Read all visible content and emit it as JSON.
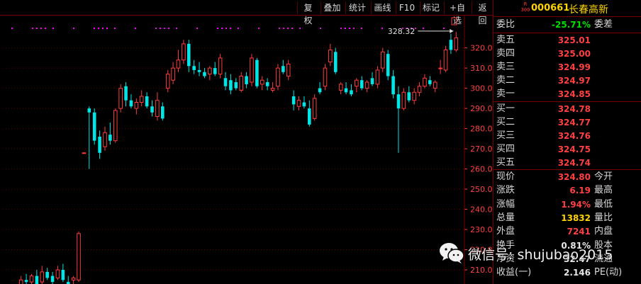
{
  "toolbar": {
    "buttons": [
      "复权",
      "叠加",
      "统计",
      "画线",
      "F10",
      "标记",
      "+自选",
      "返回"
    ]
  },
  "stock": {
    "r_badge_top": "R",
    "r_badge_bottom": "300",
    "code": "000661",
    "name": "长春高新"
  },
  "weibi": {
    "label": "委比",
    "value": "-25.71%",
    "label2": "委差"
  },
  "asks": [
    {
      "label": "卖五",
      "price": "325.01"
    },
    {
      "label": "卖四",
      "price": "325.00"
    },
    {
      "label": "卖三",
      "price": "324.99"
    },
    {
      "label": "卖二",
      "price": "324.97"
    },
    {
      "label": "卖一",
      "price": "324.85"
    }
  ],
  "bids": [
    {
      "label": "买一",
      "price": "324.78"
    },
    {
      "label": "买二",
      "price": "324.77"
    },
    {
      "label": "买三",
      "price": "324.76"
    },
    {
      "label": "买四",
      "price": "324.75"
    },
    {
      "label": "买五",
      "price": "324.74"
    }
  ],
  "quote": [
    {
      "label": "现价",
      "value": "324.80",
      "label2": "今开",
      "color": "#ff4040"
    },
    {
      "label": "涨跌",
      "value": "6.19",
      "label2": "最高",
      "color": "#ff4040"
    },
    {
      "label": "涨幅",
      "value": "1.94%",
      "label2": "最低",
      "color": "#ff4040"
    },
    {
      "label": "总量",
      "value": "13832",
      "label2": "量比",
      "color": "#ffd300"
    },
    {
      "label": "外盘",
      "value": "7241",
      "label2": "内盘",
      "color": "#ff4040"
    },
    {
      "label": "换手",
      "value": "0.81%",
      "label2": "股本",
      "color": "#e8e8e8"
    },
    {
      "label": "净资",
      "value": "32.47",
      "label2": "流通",
      "color": "#e8e8e8"
    },
    {
      "label": "收益(一)",
      "value": "2.146",
      "label2": "PE(动)",
      "color": "#e8e8e8"
    }
  ],
  "watermark": {
    "text": "微信号: shujubao2015"
  },
  "chart_data": {
    "type": "candlestick",
    "ylim": [
      203,
      336
    ],
    "yticks": [
      210,
      220,
      230,
      240,
      250,
      260,
      270,
      280,
      290,
      300,
      310,
      320
    ],
    "annotation": {
      "text": "328.32",
      "value": 328.32
    },
    "candles": [
      {
        "o": 202,
        "h": 207,
        "l": 201,
        "c": 205
      },
      {
        "o": 205,
        "h": 208,
        "l": 202,
        "c": 204
      },
      {
        "o": 204,
        "h": 208,
        "l": 203,
        "c": 207
      },
      {
        "o": 207,
        "h": 210,
        "l": 203,
        "c": 203
      },
      {
        "o": 204,
        "h": 212,
        "l": 203,
        "c": 209
      },
      {
        "o": 209,
        "h": 211,
        "l": 205,
        "c": 206
      },
      {
        "o": 207,
        "h": 209,
        "l": 203,
        "c": 204
      },
      {
        "o": 206,
        "h": 212,
        "l": 205,
        "c": 210
      },
      {
        "o": 210,
        "h": 213,
        "l": 204,
        "c": 205
      },
      {
        "o": 204,
        "h": 207,
        "l": 202,
        "c": 203
      },
      {
        "o": 205,
        "h": 207,
        "l": 203,
        "c": 206
      },
      {
        "o": 205,
        "h": 229,
        "l": 204,
        "c": 228
      },
      {
        "o": 268,
        "h": 268,
        "l": 268,
        "c": 268
      },
      {
        "o": 290,
        "h": 291,
        "l": 260,
        "c": 288
      },
      {
        "o": 288,
        "h": 290,
        "l": 272,
        "c": 274
      },
      {
        "o": 276,
        "h": 279,
        "l": 265,
        "c": 268
      },
      {
        "o": 271,
        "h": 281,
        "l": 269,
        "c": 278
      },
      {
        "o": 277,
        "h": 283,
        "l": 272,
        "c": 274
      },
      {
        "o": 274,
        "h": 290,
        "l": 273,
        "c": 289
      },
      {
        "o": 290,
        "h": 302,
        "l": 288,
        "c": 300
      },
      {
        "o": 301,
        "h": 303,
        "l": 291,
        "c": 294
      },
      {
        "o": 294,
        "h": 297,
        "l": 290,
        "c": 291
      },
      {
        "o": 290,
        "h": 295,
        "l": 287,
        "c": 293
      },
      {
        "o": 293,
        "h": 299,
        "l": 291,
        "c": 296
      },
      {
        "o": 296,
        "h": 298,
        "l": 290,
        "c": 291
      },
      {
        "o": 291,
        "h": 294,
        "l": 286,
        "c": 288
      },
      {
        "o": 286,
        "h": 298,
        "l": 284,
        "c": 294
      },
      {
        "o": 291,
        "h": 293,
        "l": 284,
        "c": 285
      },
      {
        "o": 300,
        "h": 309,
        "l": 298,
        "c": 307
      },
      {
        "o": 304,
        "h": 313,
        "l": 302,
        "c": 310
      },
      {
        "o": 310,
        "h": 319,
        "l": 308,
        "c": 314
      },
      {
        "o": 314,
        "h": 324,
        "l": 312,
        "c": 322
      },
      {
        "o": 322,
        "h": 324,
        "l": 308,
        "c": 311
      },
      {
        "o": 311,
        "h": 314,
        "l": 307,
        "c": 309
      },
      {
        "o": 309,
        "h": 313,
        "l": 306,
        "c": 308
      },
      {
        "o": 308,
        "h": 310,
        "l": 305,
        "c": 306
      },
      {
        "o": 307,
        "h": 311,
        "l": 304,
        "c": 310
      },
      {
        "o": 310,
        "h": 313,
        "l": 306,
        "c": 307
      },
      {
        "o": 307,
        "h": 317,
        "l": 305,
        "c": 315
      },
      {
        "o": 305,
        "h": 308,
        "l": 299,
        "c": 301
      },
      {
        "o": 304,
        "h": 307,
        "l": 297,
        "c": 299
      },
      {
        "o": 303,
        "h": 305,
        "l": 299,
        "c": 300
      },
      {
        "o": 299,
        "h": 308,
        "l": 298,
        "c": 306
      },
      {
        "o": 306,
        "h": 308,
        "l": 300,
        "c": 302
      },
      {
        "o": 303,
        "h": 317,
        "l": 301,
        "c": 315
      },
      {
        "o": 314,
        "h": 315,
        "l": 300,
        "c": 301
      },
      {
        "o": 302,
        "h": 306,
        "l": 299,
        "c": 304
      },
      {
        "o": 303,
        "h": 305,
        "l": 299,
        "c": 301
      },
      {
        "o": 299,
        "h": 303,
        "l": 298,
        "c": 300
      },
      {
        "o": 301,
        "h": 312,
        "l": 299,
        "c": 310
      },
      {
        "o": 311,
        "h": 314,
        "l": 307,
        "c": 308
      },
      {
        "o": 306,
        "h": 314,
        "l": 304,
        "c": 312
      },
      {
        "o": 296,
        "h": 299,
        "l": 289,
        "c": 292
      },
      {
        "o": 291,
        "h": 296,
        "l": 289,
        "c": 294
      },
      {
        "o": 293,
        "h": 296,
        "l": 290,
        "c": 291
      },
      {
        "o": 290,
        "h": 294,
        "l": 281,
        "c": 282
      },
      {
        "o": 285,
        "h": 297,
        "l": 284,
        "c": 295
      },
      {
        "o": 300,
        "h": 303,
        "l": 297,
        "c": 298
      },
      {
        "o": 301,
        "h": 312,
        "l": 299,
        "c": 310
      },
      {
        "o": 313,
        "h": 322,
        "l": 311,
        "c": 319
      },
      {
        "o": 318,
        "h": 320,
        "l": 307,
        "c": 308
      },
      {
        "o": 299,
        "h": 303,
        "l": 297,
        "c": 302
      },
      {
        "o": 300,
        "h": 303,
        "l": 297,
        "c": 298
      },
      {
        "o": 299,
        "h": 302,
        "l": 296,
        "c": 297
      },
      {
        "o": 301,
        "h": 305,
        "l": 298,
        "c": 304
      },
      {
        "o": 304,
        "h": 306,
        "l": 299,
        "c": 300
      },
      {
        "o": 300,
        "h": 304,
        "l": 298,
        "c": 303
      },
      {
        "o": 305,
        "h": 308,
        "l": 301,
        "c": 302
      },
      {
        "o": 302,
        "h": 311,
        "l": 300,
        "c": 309
      },
      {
        "o": 310,
        "h": 320,
        "l": 308,
        "c": 318
      },
      {
        "o": 317,
        "h": 319,
        "l": 304,
        "c": 306
      },
      {
        "o": 306,
        "h": 309,
        "l": 295,
        "c": 297
      },
      {
        "o": 297,
        "h": 301,
        "l": 268,
        "c": 290
      },
      {
        "o": 290,
        "h": 300,
        "l": 289,
        "c": 298
      },
      {
        "o": 298,
        "h": 301,
        "l": 293,
        "c": 294
      },
      {
        "o": 294,
        "h": 300,
        "l": 292,
        "c": 298
      },
      {
        "o": 298,
        "h": 303,
        "l": 296,
        "c": 301
      },
      {
        "o": 301,
        "h": 307,
        "l": 300,
        "c": 305
      },
      {
        "o": 304,
        "h": 306,
        "l": 301,
        "c": 302
      },
      {
        "o": 300,
        "h": 304,
        "l": 298,
        "c": 303
      },
      {
        "o": 310,
        "h": 314,
        "l": 307,
        "c": 310
      },
      {
        "o": 309,
        "h": 321,
        "l": 308,
        "c": 319
      },
      {
        "o": 324,
        "h": 327,
        "l": 317,
        "c": 319
      },
      {
        "o": 319,
        "h": 328,
        "l": 318,
        "c": 325
      }
    ]
  },
  "colors": {
    "up": "#ff3c3c",
    "down": "#00e6e6",
    "grid": "#5a0000",
    "axis_text": "#ff4040",
    "accent": "#ffd300"
  }
}
